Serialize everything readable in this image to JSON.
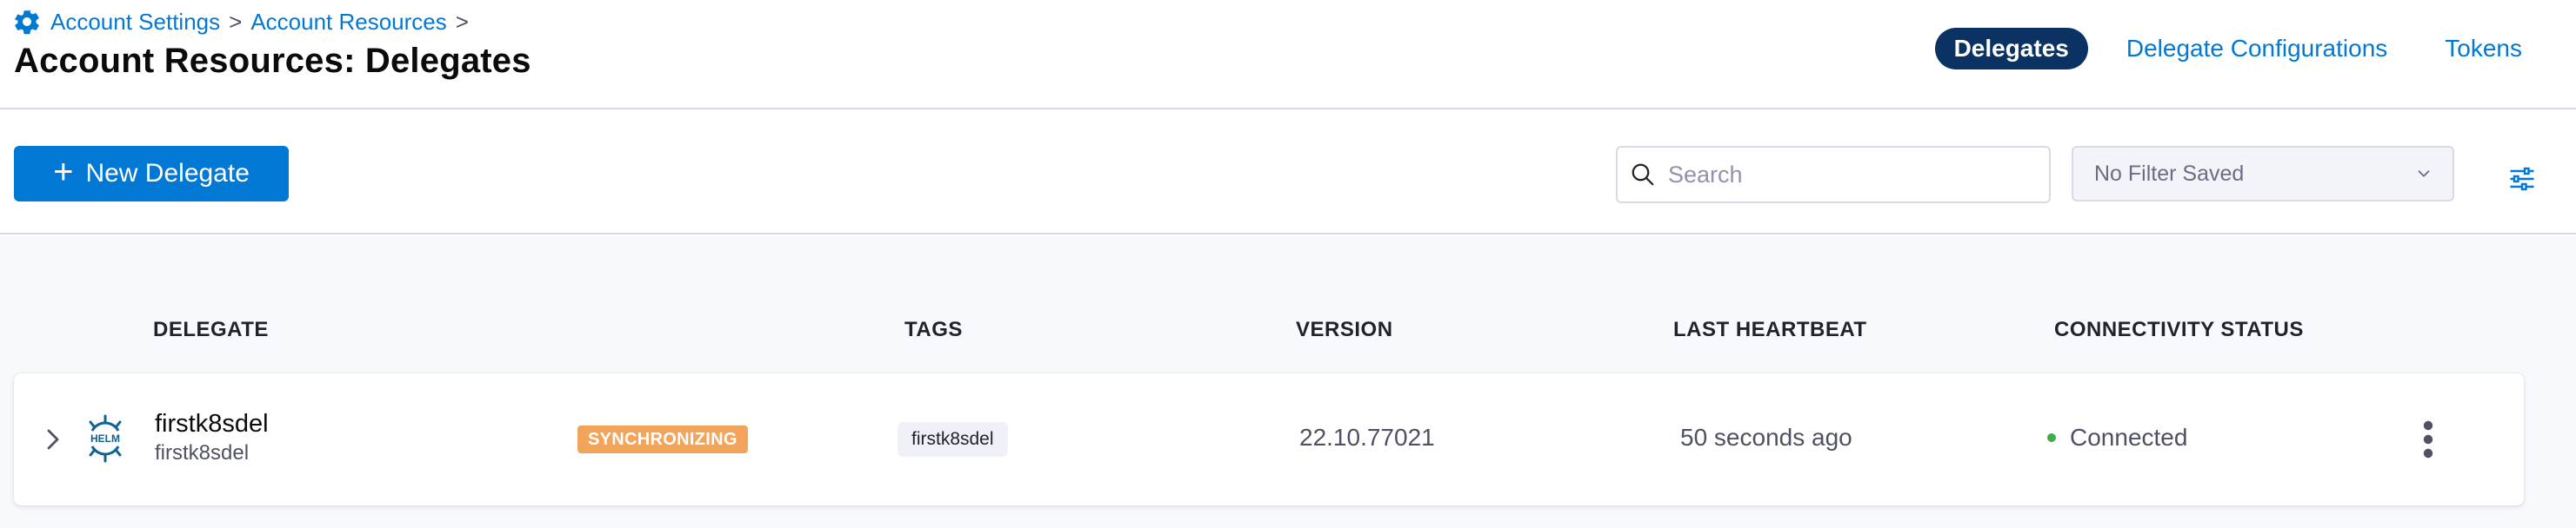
{
  "breadcrumb": {
    "items": [
      "Account Settings",
      "Account Resources"
    ],
    "separator": ">"
  },
  "page": {
    "title": "Account Resources: Delegates"
  },
  "tabs": [
    {
      "label": "Delegates",
      "active": true
    },
    {
      "label": "Delegate Configurations",
      "active": false
    },
    {
      "label": "Tokens",
      "active": false
    }
  ],
  "toolbar": {
    "new_button_label": "New Delegate",
    "search_placeholder": "Search",
    "search_value": "",
    "filter_select_value": "No Filter Saved"
  },
  "table": {
    "columns": [
      "DELEGATE",
      "TAGS",
      "VERSION",
      "LAST HEARTBEAT",
      "CONNECTIVITY STATUS"
    ],
    "rows": [
      {
        "name": "firstk8sdel",
        "sub_name": "firstk8sdel",
        "type_icon": "helm-icon",
        "helm_text": "HELM",
        "badge": "SYNCHRONIZING",
        "tags": [
          "firstk8sdel"
        ],
        "version": "22.10.77021",
        "last_heartbeat": "50 seconds ago",
        "status": "Connected",
        "status_color": "#42ab45"
      }
    ]
  },
  "colors": {
    "accent": "#0278d5",
    "active_tab_bg": "#0a3364",
    "badge_sync": "#f2a45a"
  }
}
